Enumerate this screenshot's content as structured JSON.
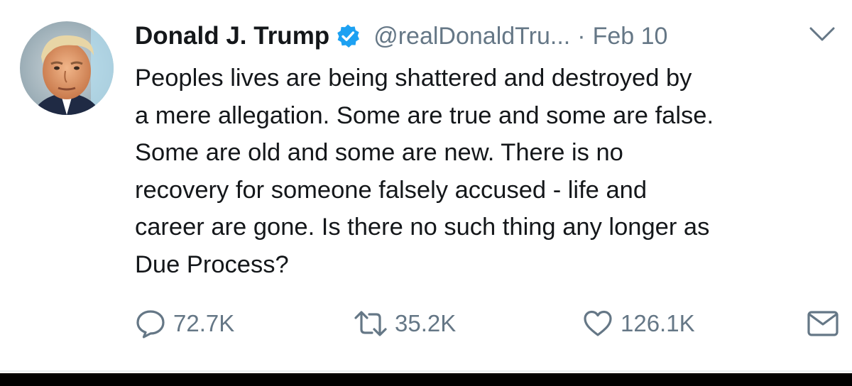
{
  "tweet": {
    "author_name": "Donald J. Trump",
    "handle": "@realDonaldTru...",
    "separator": "·",
    "date": "Feb 10",
    "text": "Peoples lives are being shattered and destroyed by\na mere allegation. Some are true and some are false.\nSome are old and some are new. There is no\nrecovery for someone falsely accused - life and\ncareer are gone. Is there no such thing any longer as\nDue Process?"
  },
  "actions": {
    "reply_count": "72.7K",
    "retweet_count": "35.2K",
    "like_count": "126.1K"
  },
  "icons": {
    "verified": "verified-badge-icon",
    "caret": "chevron-down-icon",
    "reply": "reply-icon",
    "retweet": "retweet-icon",
    "like": "heart-icon",
    "message": "envelope-icon"
  },
  "colors": {
    "text": "#14171a",
    "secondary": "#657786",
    "verified": "#1da1f2"
  }
}
